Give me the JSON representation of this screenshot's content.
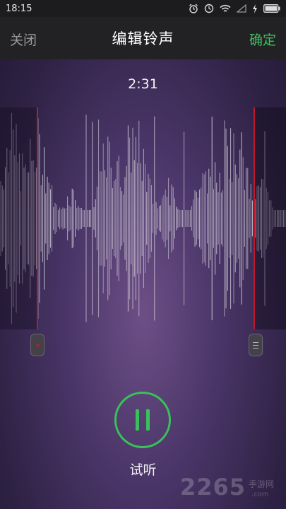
{
  "status": {
    "time": "18:15",
    "icons": [
      "alarm-icon",
      "clock-icon",
      "wifi-icon",
      "signal-icon",
      "charging-icon",
      "battery-icon"
    ]
  },
  "nav": {
    "close_label": "关闭",
    "title": "编辑铃声",
    "confirm_label": "确定"
  },
  "editor": {
    "duration": "2:31",
    "wave_color": "#d8d4dc",
    "marker_color": "#c0192b"
  },
  "player": {
    "state": "playing",
    "label": "试听",
    "accent_color": "#39c25a"
  },
  "watermark": {
    "brand": "2265",
    "sub": "手游网",
    "domain": ".com"
  }
}
